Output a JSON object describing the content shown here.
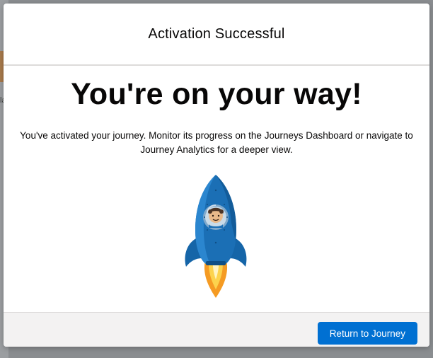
{
  "background": {
    "partial_text": "la"
  },
  "modal": {
    "title": "Activation Successful",
    "heading": "You're on your way!",
    "message": "You've activated your journey. Monitor its progress on the Journeys Dashboard or navigate to Journey Analytics for a deeper view.",
    "illustration": "rocket-astronaut-icon",
    "footer": {
      "primary_label": "Return to Journey"
    }
  },
  "colors": {
    "brand": "#0070d2",
    "rocket": "#1b6fb5",
    "flame": "#f59b23"
  }
}
